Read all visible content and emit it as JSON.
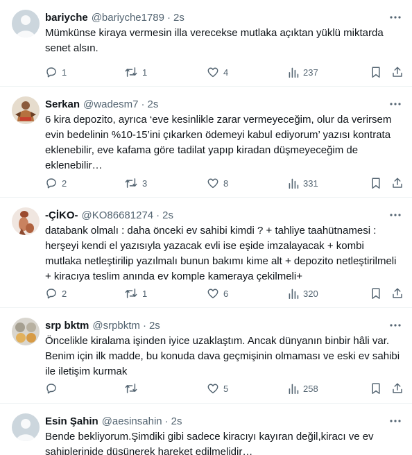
{
  "tweets": [
    {
      "name": "bariyche",
      "handle": "@bariyche1789",
      "time": "2s",
      "text": "Mümkünse kiraya vermesin illa verecekse mutlaka açıktan yüklü miktarda senet alsın.",
      "replies": "1",
      "retweets": "1",
      "likes": "4",
      "views": "237",
      "avatar": "default"
    },
    {
      "name": "Serkan",
      "handle": "@wadesm7",
      "time": "2s",
      "text": "6 kira depozito, ayrıca ‘eve kesinlikle zarar vermeyeceğim, olur da verirsem evin bedelinin %10-15’ini çıkarken ödemeyi kabul ediyorum’ yazısı kontrata eklenebilir, eve kafama göre tadilat yapıp kiradan düşmeyeceğim de eklenebilir…",
      "replies": "2",
      "retweets": "3",
      "likes": "8",
      "views": "331",
      "avatar": "photo"
    },
    {
      "name": "-ÇİKO-",
      "handle": "@KO86681274",
      "time": "2s",
      "text": "databank olmalı : daha önceki ev sahibi kimdi ? + tahliye taahütnamesi : herşeyi kendi el yazısıyla yazacak evli ise eşide imzalayacak + kombi mutlaka netleştirilip yazılmalı bunun bakımı kime alt + depozito netleştirilmeli + kiracıya teslim anında ev komple kameraya çekilmeli+",
      "replies": "2",
      "retweets": "1",
      "likes": "6",
      "views": "320",
      "avatar": "photo"
    },
    {
      "name": "srp bktm",
      "handle": "@srpbktm",
      "time": "2s",
      "text": "Öncelikle kiralama işinden iyice uzaklaştım. Ancak dünyanın binbir hâli var. Benim için ilk madde, bu konuda dava geçmişinin olmaması ve eski ev sahibi ile iletişim kurmak",
      "replies": "",
      "retweets": "",
      "likes": "5",
      "views": "258",
      "avatar": "photo"
    },
    {
      "name": "Esin Şahin",
      "handle": "@aesinsahin",
      "time": "2s",
      "text": "Bende bekliyorum.Şimdiki gibi sadece kiracıyı kayıran değil,kiracı ve ev sahiplerinide düşünerek hareket edilmelidir…",
      "avatar": "default"
    }
  ],
  "colors": {
    "text": "#0f1419",
    "secondary": "#536471",
    "divider": "#eff3f4",
    "default_avatar": "#ccd6dd"
  },
  "icons": [
    "reply-icon",
    "retweet-icon",
    "like-icon",
    "views-icon",
    "bookmark-icon",
    "share-icon",
    "more-icon"
  ]
}
